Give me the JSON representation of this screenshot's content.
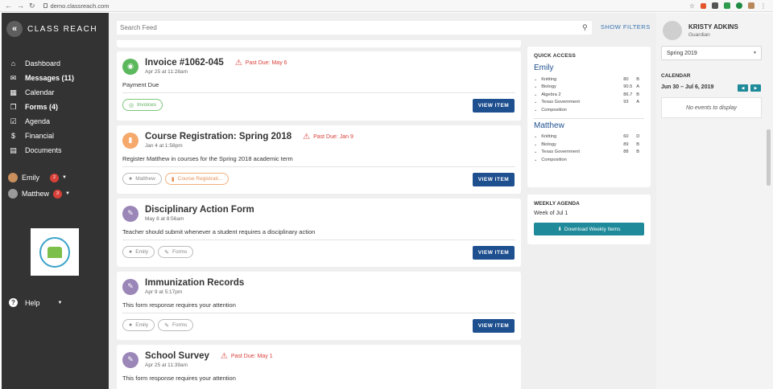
{
  "browser": {
    "url": "demo.classreach.com"
  },
  "brand": {
    "name": "CLASS REACH"
  },
  "sidebar": {
    "items": [
      {
        "label": "Dashboard",
        "icon": "home-icon"
      },
      {
        "label": "Messages (11)",
        "icon": "envelope-icon"
      },
      {
        "label": "Calendar",
        "icon": "calendar-icon"
      },
      {
        "label": "Forms (4)",
        "icon": "forms-icon"
      },
      {
        "label": "Agenda",
        "icon": "agenda-icon"
      },
      {
        "label": "Financial",
        "icon": "dollar-icon"
      },
      {
        "label": "Documents",
        "icon": "document-icon"
      }
    ],
    "students": [
      {
        "name": "Emily",
        "badge": "2"
      },
      {
        "name": "Matthew",
        "badge": "3"
      }
    ],
    "help": "Help"
  },
  "search": {
    "placeholder": "Search Feed"
  },
  "filters_label": "SHOW FILTERS",
  "feed": [
    {
      "title": "Invoice #1062-045",
      "pastdue": "Past Due: May 6",
      "date": "Apr 25 at 11:28am",
      "desc": "Payment Due",
      "color": "#5cb85c",
      "tags": [
        {
          "label": "Invoices",
          "style": "green"
        }
      ],
      "button": "VIEW ITEM"
    },
    {
      "title": "Course Registration: Spring 2018",
      "pastdue": "Past Due: Jan 9",
      "date": "Jan 4 at 1:58pm",
      "desc": "Register Matthew in courses for the Spring 2018 academic term",
      "color": "#f5a96b",
      "tags": [
        {
          "label": "Matthew",
          "style": ""
        },
        {
          "label": "Course Registrati...",
          "style": "orange"
        }
      ],
      "button": "VIEW ITEM"
    },
    {
      "title": "Disciplinary Action Form",
      "pastdue": "",
      "date": "May 8 at 8:56am",
      "desc": "Teacher should submit whenever a student requires a disciplinary action",
      "color": "#9b86b8",
      "tags": [
        {
          "label": "Emily",
          "style": ""
        },
        {
          "label": "Forms",
          "style": ""
        }
      ],
      "button": "VIEW ITEM"
    },
    {
      "title": "Immunization Records",
      "pastdue": "",
      "date": "Apr 9 at 5:17pm",
      "desc": "This form response requires your attention",
      "color": "#9b86b8",
      "tags": [
        {
          "label": "Emily",
          "style": ""
        },
        {
          "label": "Forms",
          "style": ""
        }
      ],
      "button": "VIEW ITEM"
    },
    {
      "title": "School Survey",
      "pastdue": "Past Due: May 1",
      "date": "Apr 25 at 11:39am",
      "desc": "This form response requires your attention",
      "color": "#9b86b8",
      "tags": [],
      "button": ""
    }
  ],
  "quick_access": {
    "heading": "QUICK ACCESS",
    "students": [
      {
        "name": "Emily",
        "courses": [
          {
            "name": "Knitting",
            "grade": "80",
            "letter": "B"
          },
          {
            "name": "Biology",
            "grade": "90.5",
            "letter": "A"
          },
          {
            "name": "Algebra 2",
            "grade": "86.7",
            "letter": "B"
          },
          {
            "name": "Texas Government",
            "grade": "93",
            "letter": "A"
          },
          {
            "name": "Composition",
            "grade": "",
            "letter": ""
          }
        ]
      },
      {
        "name": "Matthew",
        "courses": [
          {
            "name": "Knitting",
            "grade": "60",
            "letter": "D"
          },
          {
            "name": "Biology",
            "grade": "89",
            "letter": "B"
          },
          {
            "name": "Texas Government",
            "grade": "88",
            "letter": "B"
          },
          {
            "name": "Composition",
            "grade": "",
            "letter": ""
          }
        ]
      }
    ]
  },
  "weekly_agenda": {
    "heading": "WEEKLY AGENDA",
    "week": "Week of Jul 1",
    "download": "Download Weekly Items"
  },
  "right_panel": {
    "user_name": "KRISTY ADKINS",
    "user_role": "Guardian",
    "term": "Spring 2019",
    "calendar_heading": "CALENDAR",
    "range": "Jun 30 – Jul 6, 2019",
    "no_events": "No events to display"
  }
}
